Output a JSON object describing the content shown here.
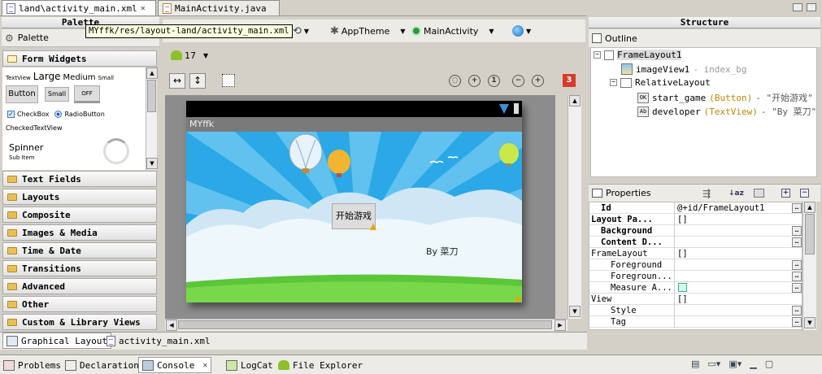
{
  "editor_tabs": [
    {
      "label": "land\\activity_main.xml",
      "active": true
    },
    {
      "label": "MainActivity.java",
      "active": false
    }
  ],
  "tooltip": "MYffk/res/layout-land/activity_main.xml",
  "palette": {
    "header": "Palette",
    "title": "Palette",
    "form_widgets": "Form Widgets",
    "widgets": {
      "textview": "TextView",
      "large": "Large",
      "medium": "Medium",
      "small": "Small",
      "button": "Button",
      "small_btn": "Small",
      "off": "OFF",
      "checkbox": "CheckBox",
      "radio": "RadioButton",
      "checked_tv": "CheckedTextView",
      "spinner": "Spinner",
      "sub_item": "Sub Item"
    },
    "categories": [
      "Text Fields",
      "Layouts",
      "Composite",
      "Images & Media",
      "Time & Date",
      "Transitions",
      "Advanced",
      "Other",
      "Custom & Library Views"
    ]
  },
  "toolbar": {
    "theme": "AppTheme",
    "activity": "MainActivity",
    "api": "17",
    "error_count": "3"
  },
  "device": {
    "app_title": "MYffk",
    "start_button": "开始游戏",
    "developer": "By 菜刀"
  },
  "structure": {
    "header": "Structure",
    "outline_title": "Outline",
    "outline": [
      {
        "name": "FrameLayout1",
        "extra": ""
      },
      {
        "name": "imageView1",
        "extra": " - index_bg"
      },
      {
        "name": "RelativeLayout",
        "extra": ""
      },
      {
        "name": "start_game",
        "type": "(Button)",
        "extra": " - \"开始游戏\""
      },
      {
        "name": "developer",
        "type": "(TextView)",
        "extra": " - \"By 菜刀\""
      }
    ]
  },
  "properties": {
    "title": "Properties",
    "rows": [
      {
        "name": "Id",
        "value": "@+id/FrameLayout1",
        "bold": true
      },
      {
        "name": "Layout Pa...",
        "value": "[]",
        "bold": true
      },
      {
        "name": "Background",
        "value": "",
        "bold": true
      },
      {
        "name": "Content D...",
        "value": "",
        "bold": true
      },
      {
        "name": "FrameLayout",
        "value": "[]",
        "bold": false
      },
      {
        "name": "Foreground",
        "value": "",
        "bold": false
      },
      {
        "name": "Foregroun...",
        "value": "",
        "bold": false
      },
      {
        "name": "Measure A...",
        "value": "",
        "bold": false
      },
      {
        "name": "View",
        "value": "[]",
        "bold": false
      },
      {
        "name": "Style",
        "value": "",
        "bold": false
      },
      {
        "name": "Tag",
        "value": "",
        "bold": false
      }
    ]
  },
  "bottom_editor_tabs": [
    "Graphical Layout",
    "activity_main.xml"
  ],
  "bottom_tabs": [
    "Problems",
    "Declaration",
    "Console",
    "LogCat",
    "File Explorer"
  ],
  "colors": {
    "sky": "#2ba8e6",
    "ray": "#7fd0f5",
    "grass": "#5cc63a",
    "warning": "#e6a600",
    "error": "#d63a2a"
  }
}
